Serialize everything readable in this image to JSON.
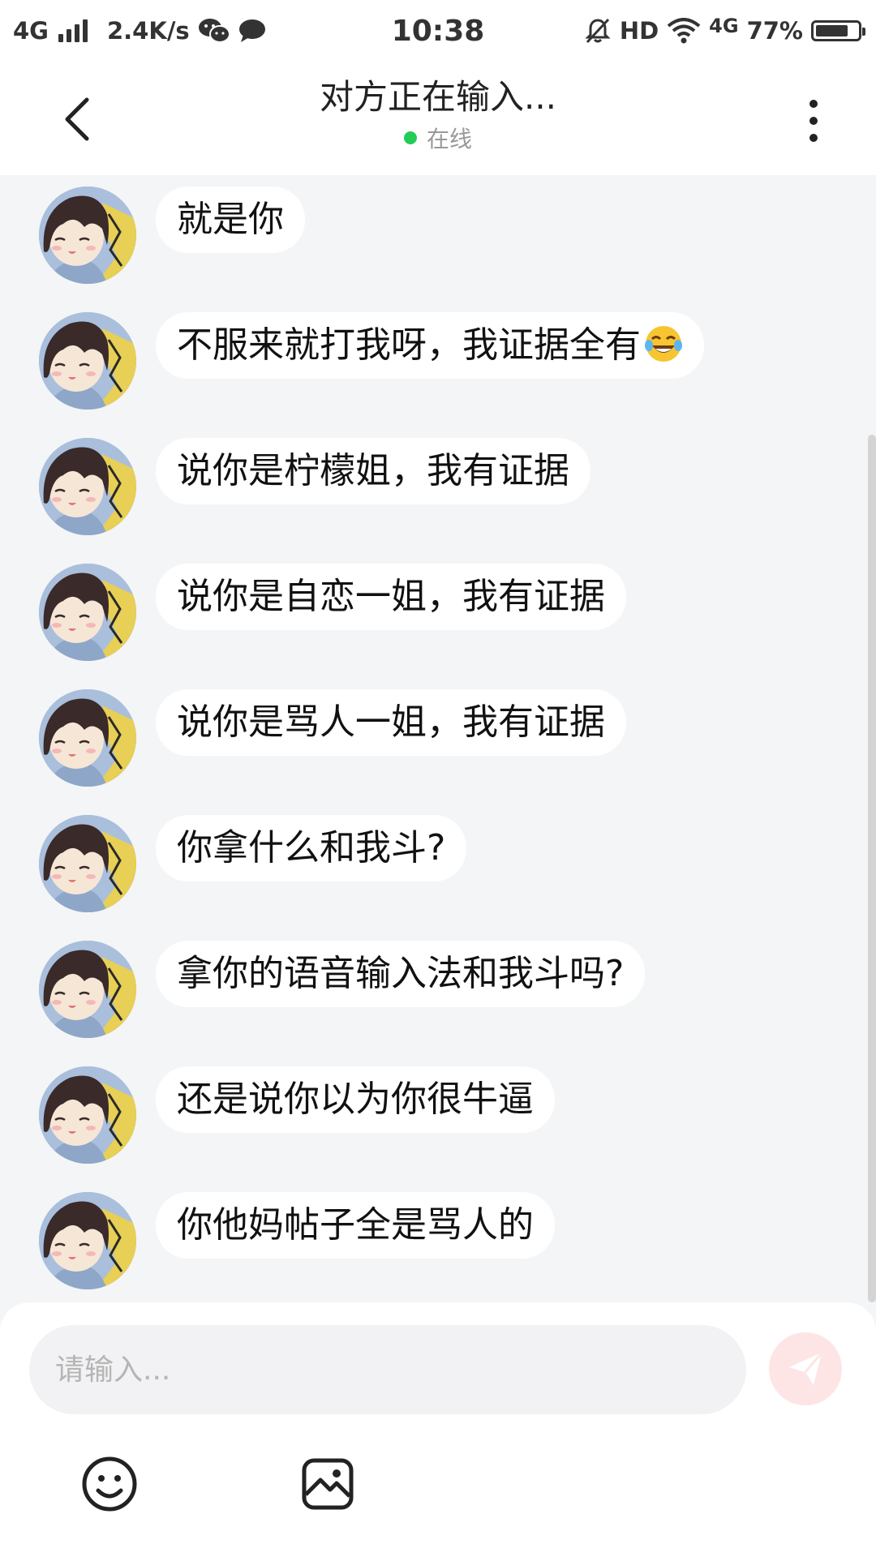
{
  "status_bar": {
    "network_type": "4G",
    "speed": "2.4K/s",
    "time": "10:38",
    "hd": "HD",
    "network_type_2": "4G",
    "battery": "77%",
    "battery_level": 0.77,
    "icons": [
      "signal-icon",
      "wechat-icon",
      "message-icon",
      "mute-bell-icon",
      "wifi-icon",
      "battery-icon"
    ]
  },
  "header": {
    "title": "对方正在输入...",
    "presence": "在线",
    "presence_color": "#22cc55"
  },
  "messages": [
    {
      "text": "就是你"
    },
    {
      "text": "不服来就打我呀，我证据全有",
      "emoji": "face-with-tears-of-joy-icon"
    },
    {
      "text": "说你是柠檬姐，我有证据"
    },
    {
      "text": "说你是自恋一姐，我有证据"
    },
    {
      "text": "说你是骂人一姐，我有证据"
    },
    {
      "text": "你拿什么和我斗?"
    },
    {
      "text": "拿你的语音输入法和我斗吗?"
    },
    {
      "text": "还是说你以为你很牛逼"
    },
    {
      "text": "你他妈帖子全是骂人的"
    }
  ],
  "composer": {
    "placeholder": "请输入...",
    "value": "",
    "send_icon": "send-icon",
    "send_color": "#fde5e5",
    "tools": [
      "emoji-icon",
      "image-icon"
    ]
  }
}
